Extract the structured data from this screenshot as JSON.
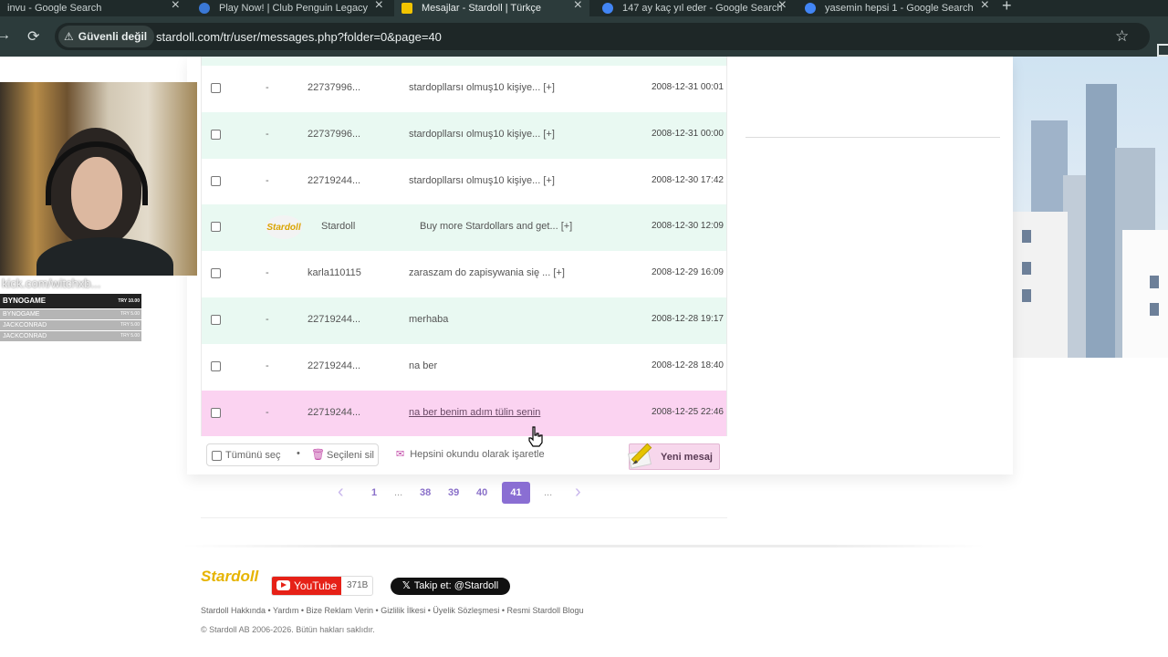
{
  "browser": {
    "tabs": [
      {
        "title": "invu - Google Search",
        "active": false,
        "favicon_color": "#4285f4"
      },
      {
        "title": "Play Now! | Club Penguin Legacy",
        "active": false,
        "favicon_color": "#3a78d6"
      },
      {
        "title": "Mesajlar - Stardoll | Türkçe",
        "active": true,
        "favicon_color": "#f2c400"
      },
      {
        "title": "147 ay kaç yıl eder - Google Search",
        "active": false,
        "favicon_color": "#4285f4"
      },
      {
        "title": "yasemin hepsi 1 - Google Search",
        "active": false,
        "favicon_color": "#4285f4"
      }
    ],
    "security_label": "Güvenli değil",
    "url": "stardoll.com/tr/user/messages.php?folder=0&page=40"
  },
  "messages": [
    {
      "sender": "22737996...",
      "has_avatar": false,
      "subject": "stardopllarsı olmuş10 kişiye... [+]",
      "date": "2008-12-31 00:01",
      "style": "normal"
    },
    {
      "sender": "22737996...",
      "has_avatar": false,
      "subject": "stardopllarsı olmuş10 kişiye... [+]",
      "date": "2008-12-31 00:00",
      "style": "alt"
    },
    {
      "sender": "22719244...",
      "has_avatar": false,
      "subject": "stardopllarsı olmuş10 kişiye... [+]",
      "date": "2008-12-30 17:42",
      "style": "normal"
    },
    {
      "sender": "Stardoll",
      "has_avatar": true,
      "subject": "Buy more Stardollars and get... [+]",
      "date": "2008-12-30 12:09",
      "style": "alt"
    },
    {
      "sender": "karla110115",
      "has_avatar": false,
      "subject": "zaraszam do zapisywania się ... [+]",
      "date": "2008-12-29 16:09",
      "style": "normal"
    },
    {
      "sender": "22719244...",
      "has_avatar": false,
      "subject": "merhaba",
      "date": "2008-12-28 19:17",
      "style": "alt"
    },
    {
      "sender": "22719244...",
      "has_avatar": false,
      "subject": "na ber",
      "date": "2008-12-28 18:40",
      "style": "normal"
    },
    {
      "sender": "22719244...",
      "has_avatar": false,
      "subject": "na ber benim adım tülin senin",
      "date": "2008-12-25 22:46",
      "style": "unread"
    }
  ],
  "row_dash": "-",
  "avatar_text": "Stardoll",
  "actions": {
    "select_all": "Tümünü seç",
    "delete_selected": "Seçileni sil",
    "mark_all_read": "Hepsini okundu olarak işaretle",
    "new_message": "Yeni mesaj"
  },
  "pagination": {
    "pages": [
      "1",
      "...",
      "38",
      "39",
      "40",
      "41",
      "..."
    ],
    "current": "41"
  },
  "footer": {
    "logo": "Stardoll",
    "youtube_label": "YouTube",
    "youtube_count": "371B",
    "twitter_label": "Takip et: @Stardoll",
    "links": "Stardoll Hakkında • Yardım • Bize Reklam Verin • Gizlilik İlkesi • Üyelik Sözleşmesi • Resmi Stardoll Blogu",
    "copyright": "© Stardoll AB 2006-2026. Bütün hakları saklıdır."
  },
  "overlay": {
    "url_text": "kick.com/witchxb...",
    "header": "BYNOGAME",
    "header_right": "TRY 10.00",
    "lines": [
      {
        "name": "BYNOGAME",
        "right": "TRY 5.00"
      },
      {
        "name": "JACKCONRAD",
        "right": "TRY 5.00"
      },
      {
        "name": "JACKCONRAD",
        "right": "TRY 5.00"
      }
    ]
  },
  "colors": {
    "row_alt": "#e9f9f2",
    "row_unread": "#fbd3f1",
    "pager_current": "#8a6ed3",
    "youtube_red": "#e62117"
  },
  "icons": {
    "back": "arrow-left-icon",
    "reload": "reload-icon",
    "warning": "warning-icon",
    "star": "bookmark-star-icon",
    "trash": "trash-icon",
    "envelope": "envelope-icon",
    "pencil": "pencil-icon"
  }
}
